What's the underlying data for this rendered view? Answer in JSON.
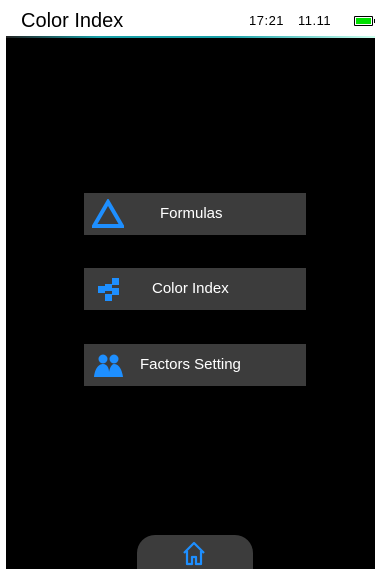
{
  "header": {
    "title": "Color Index",
    "time": "17:21",
    "date": "11.11"
  },
  "menu": {
    "items": [
      {
        "label": "Formulas",
        "icon": "triangle-icon"
      },
      {
        "label": "Color Index",
        "icon": "checker-icon"
      },
      {
        "label": "Factors Setting",
        "icon": "people-icon"
      }
    ]
  },
  "footer": {
    "home_icon": "home-icon"
  },
  "colors": {
    "accent": "#1e8fff",
    "button_bg": "#3c3c3c",
    "battery": "#00e000",
    "background": "#000000"
  }
}
